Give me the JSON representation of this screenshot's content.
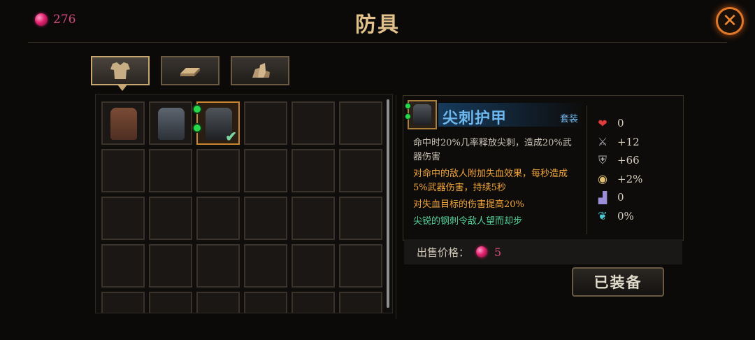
{
  "header": {
    "currency_amount": "276",
    "title": "防具",
    "close_icon": "close-icon"
  },
  "tabs": [
    {
      "name": "tab-body-armor",
      "icon": "body-armor-icon",
      "active": true
    },
    {
      "name": "tab-ingots",
      "icon": "ingot-icon",
      "active": false
    },
    {
      "name": "tab-ore",
      "icon": "ore-crystal-icon",
      "active": false
    }
  ],
  "inventory": {
    "items": [
      {
        "slot": 0,
        "icon": "leather-armor-icon"
      },
      {
        "slot": 1,
        "icon": "steel-armor-icon"
      },
      {
        "slot": 2,
        "icon": "spike-armor-icon",
        "selected": true,
        "equipped": true,
        "sockets": 2
      }
    ]
  },
  "detail": {
    "name": "尖刺护甲",
    "set_tag": "套装",
    "desc_white": "命中时20%几率释放尖刺，造成20%武器伤害",
    "desc_orange_1": "对命中的敌人附加失血效果，每秒造成5%武器伤害，持续5秒",
    "desc_orange_2": "对失血目标的伤害提高20%",
    "desc_green": "尖锐的钢刺令敌人望而却步",
    "stats": [
      {
        "icon": "heart-icon",
        "value": "0"
      },
      {
        "icon": "sword-icon",
        "value": "+12"
      },
      {
        "icon": "shield-icon",
        "value": "+66"
      },
      {
        "icon": "crit-target-icon",
        "value": "+2%"
      },
      {
        "icon": "boot-icon",
        "value": "0"
      },
      {
        "icon": "lifesteal-icon",
        "value": "0%"
      }
    ]
  },
  "sale": {
    "label": "出售价格：",
    "price": "5"
  },
  "equip_button": "已装备",
  "colors": {
    "title_gold": "#e2c18c",
    "item_name_blue": "#6fb8ee",
    "effect_orange": "#f2a53a",
    "flavor_green": "#54d09a",
    "gem_pink": "#d0487e"
  }
}
